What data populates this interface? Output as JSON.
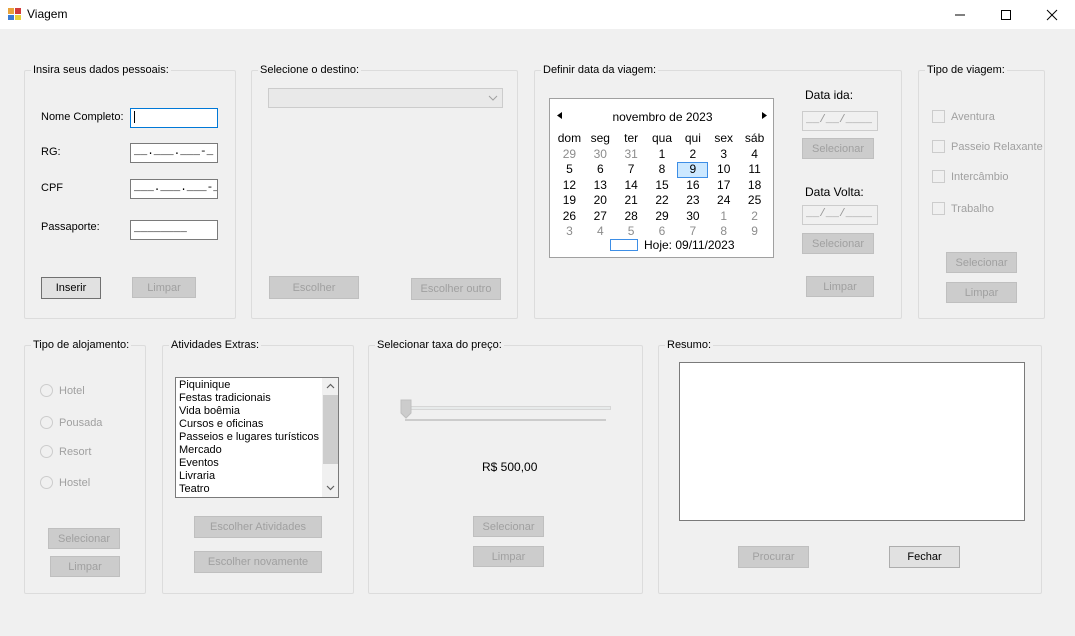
{
  "window": {
    "title": "Viagem",
    "icon": "app-icon",
    "minimize_icon": "minimize-icon",
    "maximize_icon": "maximize-icon",
    "close_icon": "close-icon"
  },
  "personal": {
    "title": "Insira seus dados pessoais:",
    "name_label": "Nome Completo:",
    "name_value": "",
    "rg_label": "RG:",
    "rg_value": "__.___.___-_",
    "cpf_label": "CPF",
    "cpf_value": "___.___.___-__",
    "passport_label": "Passaporte:",
    "passport_value": "________",
    "insert_button": "Inserir",
    "clear_button": "Limpar"
  },
  "destination": {
    "title": "Selecione o destino:",
    "selected": "",
    "choose_button": "Escolher",
    "choose_other_button": "Escolher outro"
  },
  "date": {
    "title": "Definir data da viagem:",
    "month_label": "novembro de 2023",
    "weekdays": [
      "dom",
      "seg",
      "ter",
      "qua",
      "qui",
      "sex",
      "sáb"
    ],
    "weeks": [
      [
        "29",
        "30",
        "31",
        "1",
        "2",
        "3",
        "4"
      ],
      [
        "5",
        "6",
        "7",
        "8",
        "9",
        "10",
        "11"
      ],
      [
        "12",
        "13",
        "14",
        "15",
        "16",
        "17",
        "18"
      ],
      [
        "19",
        "20",
        "21",
        "22",
        "23",
        "24",
        "25"
      ],
      [
        "26",
        "27",
        "28",
        "29",
        "30",
        "1",
        "2"
      ],
      [
        "3",
        "4",
        "5",
        "6",
        "7",
        "8",
        "9"
      ]
    ],
    "today_label": "Hoje: 09/11/2023",
    "departure_label": "Data ida:",
    "departure_value": "__/__/____",
    "departure_select_button": "Selecionar",
    "return_label": "Data Volta:",
    "return_value": "__/__/____",
    "return_select_button": "Selecionar",
    "clear_button": "Limpar"
  },
  "trip_type": {
    "title": "Tipo de viagem:",
    "options": [
      "Aventura",
      "Passeio Relaxante",
      "Intercâmbio",
      "Trabalho"
    ],
    "select_button": "Selecionar",
    "clear_button": "Limpar"
  },
  "lodging": {
    "title": "Tipo de alojamento:",
    "options": [
      "Hotel",
      "Pousada",
      "Resort",
      "Hostel"
    ],
    "select_button": "Selecionar",
    "clear_button": "Limpar"
  },
  "activities": {
    "title": "Atividades Extras:",
    "items": [
      "Piquinique",
      "Festas tradicionais",
      "Vida boêmia",
      "Cursos e oficinas",
      "Passeios e lugares turísticos",
      "Mercado",
      "Eventos",
      "Livraria",
      "Teatro"
    ],
    "choose_button": "Escolher Atividades",
    "choose_again_button": "Escolher novamente"
  },
  "price": {
    "title": "Selecionar taxa do preço:",
    "value_label": "R$ 500,00",
    "slider_position": 0,
    "select_button": "Selecionar",
    "clear_button": "Limpar"
  },
  "summary": {
    "title": "Resumo:",
    "text": "",
    "search_button": "Procurar",
    "close_button": "Fechar"
  }
}
